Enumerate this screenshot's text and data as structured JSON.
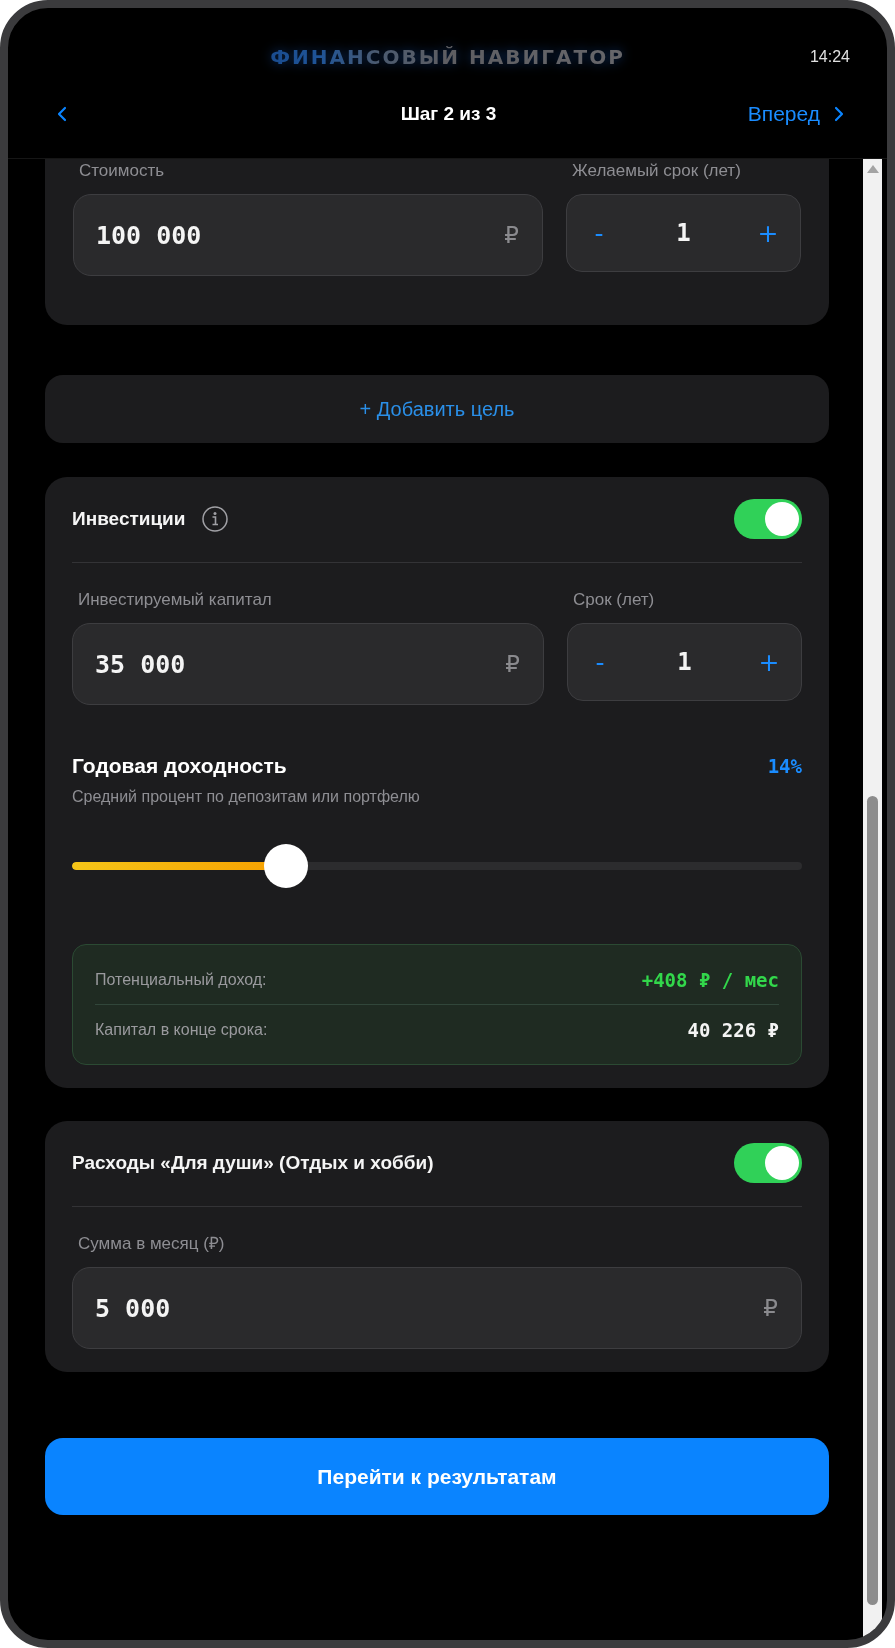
{
  "status_bar": {
    "app_title": "ФИНАНСОВЫЙ НАВИГАТОР",
    "time": "14:24"
  },
  "nav": {
    "step": "Шаг 2 из 3",
    "next": "Вперед"
  },
  "goal": {
    "fields": [
      {
        "kind": "amount",
        "label": "Стоимость",
        "value": "100 000",
        "currency": "₽"
      },
      {
        "kind": "stepper",
        "label": "Желаемый срок (лет)",
        "value": "1",
        "minus": "-",
        "plus": "+"
      }
    ]
  },
  "add_goal": "+ Добавить цель",
  "sections": [
    {
      "title": "Инвестиции",
      "info": true,
      "on": true,
      "fields": [
        {
          "kind": "amount",
          "label": "Инвестируемый капитал",
          "value": "35 000",
          "currency": "₽"
        },
        {
          "kind": "stepper",
          "label": "Срок (лет)",
          "value": "1",
          "minus": "-",
          "plus": "+"
        }
      ],
      "rate": {
        "title": "Годовая доходность",
        "value": "14%",
        "hint": "Средний процент по депозитам или портфелю",
        "level": 0.28
      },
      "results": [
        {
          "kind": "gain",
          "label": "Потенциальный доход:",
          "value": "+408 ₽ / мес"
        },
        {
          "kind": "plain",
          "label": "Капитал в конце срока:",
          "value": "40 226 ₽"
        }
      ]
    },
    {
      "title": "Расходы «Для души» (Отдых и хобби)",
      "info": false,
      "on": true,
      "fields": [
        {
          "kind": "amount",
          "label": "Сумма в месяц (₽)",
          "value": "5 000",
          "currency": "₽"
        }
      ]
    }
  ],
  "submit": "Перейти к результатам"
}
